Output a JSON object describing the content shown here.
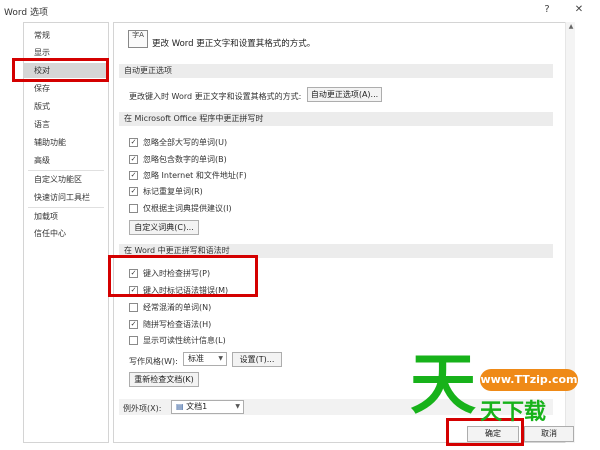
{
  "window": {
    "title": "Word 选项",
    "help_glyph": "?",
    "close_glyph": "✕"
  },
  "sidebar": {
    "items": [
      {
        "label": "常规"
      },
      {
        "label": "显示"
      },
      {
        "label": "校对",
        "selected": true
      },
      {
        "label": "保存"
      },
      {
        "label": "版式"
      },
      {
        "label": "语言"
      },
      {
        "label": "辅助功能"
      },
      {
        "label": "高级"
      },
      {
        "label": "自定义功能区"
      },
      {
        "label": "快速访问工具栏"
      },
      {
        "label": "加载项"
      },
      {
        "label": "信任中心"
      }
    ]
  },
  "header": {
    "icon_name": "proofing-abc-icon",
    "icon_text": "字A",
    "text": "更改 Word 更正文字和设置其格式的方式。"
  },
  "autocorrect": {
    "section_title": "自动更正选项",
    "row_label": "更改键入时 Word 更正文字和设置其格式的方式:",
    "button": "自动更正选项(A)..."
  },
  "office_spelling": {
    "section_title": "在 Microsoft Office 程序中更正拼写时",
    "options": [
      {
        "label": "忽略全部大写的单词(U)",
        "checked": true
      },
      {
        "label": "忽略包含数字的单词(B)",
        "checked": true
      },
      {
        "label": "忽略 Internet 和文件地址(F)",
        "checked": true
      },
      {
        "label": "标记重复单词(R)",
        "checked": true
      },
      {
        "label": "仅根据主词典提供建议(I)",
        "checked": false
      }
    ],
    "custom_dict_button": "自定义词典(C)..."
  },
  "word_spelling": {
    "section_title": "在 Word 中更正拼写和语法时",
    "options": [
      {
        "label": "键入时检查拼写(P)",
        "checked": true
      },
      {
        "label": "键入时标记语法错误(M)",
        "checked": true
      },
      {
        "label": "经常混淆的单词(N)",
        "checked": false
      },
      {
        "label": "随拼写检查语法(H)",
        "checked": true
      },
      {
        "label": "显示可读性统计信息(L)",
        "checked": false
      }
    ],
    "writing_style_label": "写作风格(W):",
    "writing_style_value": "标准",
    "settings_button": "设置(T)...",
    "recheck_button": "重新检查文档(K)"
  },
  "exceptions": {
    "label": "例外项(X):",
    "value": "文档1",
    "doc_icon": "document-icon"
  },
  "footer": {
    "ok": "确定",
    "cancel": "取消"
  },
  "watermark": {
    "url": "www.TTzip.com",
    "big_char": "天",
    "text": "天下载"
  },
  "colors": {
    "highlight": "#d40000",
    "watermark_green": "#17b21a",
    "watermark_orange": "#ef8a17"
  }
}
